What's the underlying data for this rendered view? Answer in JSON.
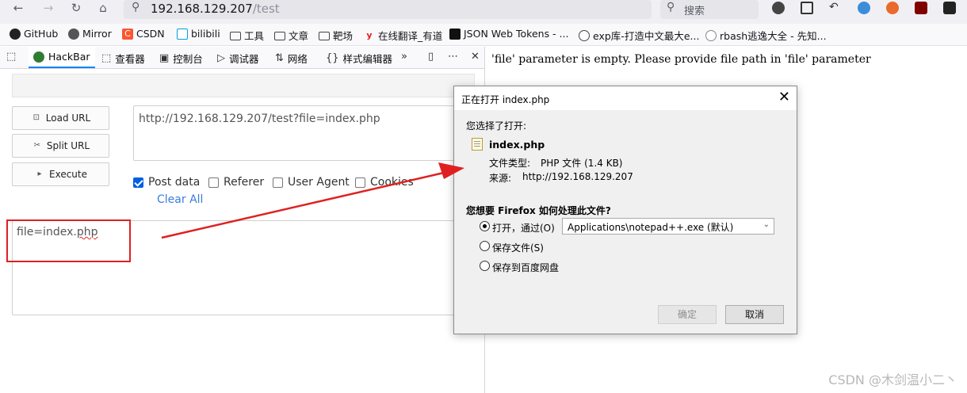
{
  "browser": {
    "url_host": "192.168.129.207",
    "url_path": "/test",
    "search_placeholder": "搜索"
  },
  "bookmarks": [
    {
      "label": "GitHub",
      "icon": "github-icon"
    },
    {
      "label": "Mirror",
      "icon": "mirror-icon"
    },
    {
      "label": "CSDN",
      "icon": "csdn-icon"
    },
    {
      "label": "bilibili",
      "icon": "bilibili-icon"
    },
    {
      "label": "工具",
      "icon": "folder-icon"
    },
    {
      "label": "文章",
      "icon": "folder-icon"
    },
    {
      "label": "靶场",
      "icon": "folder-icon"
    },
    {
      "label": "在线翻译_有道",
      "icon": "youdao-icon"
    },
    {
      "label": "JSON Web Tokens - ...",
      "icon": "jwt-icon"
    },
    {
      "label": "exp库-打造中文最大e...",
      "icon": "globe-icon"
    },
    {
      "label": "rbash逃逸大全 - 先知...",
      "icon": "xianzhi-icon"
    }
  ],
  "devtools": {
    "tabs": [
      {
        "label": "HackBar",
        "icon": "hackbar-icon"
      },
      {
        "label": "查看器",
        "icon": "inspector-icon"
      },
      {
        "label": "控制台",
        "icon": "console-icon"
      },
      {
        "label": "调试器",
        "icon": "debugger-icon"
      },
      {
        "label": "网络",
        "icon": "network-icon"
      },
      {
        "label": "样式编辑器",
        "icon": "style-editor-icon"
      }
    ]
  },
  "hackbar": {
    "load_url": "Load URL",
    "split_url": "Split URL",
    "execute": "Execute",
    "url_value": "http://192.168.129.207/test?file=index.php",
    "options": [
      {
        "label": "Post data",
        "checked": true
      },
      {
        "label": "Referer",
        "checked": false
      },
      {
        "label": "User Agent",
        "checked": false
      },
      {
        "label": "Cookies",
        "checked": false
      }
    ],
    "clear_all": "Clear All",
    "post_value_prefix": "file=index.",
    "post_value_suffix": "php"
  },
  "page": {
    "message": "'file' parameter is empty. Please provide file path in 'file' parameter"
  },
  "dialog": {
    "title": "正在打开 index.php",
    "you_chose": "您选择了打开:",
    "file_name": "index.php",
    "type_label": "文件类型:",
    "type_value": "PHP 文件 (1.4 KB)",
    "source_label": "来源:",
    "source_value": "http://192.168.129.207",
    "question": "您想要 Firefox 如何处理此文件?",
    "open_with": "打开，通过(O)",
    "app_selected": "Applications\\notepad++.exe (默认)",
    "save_file": "保存文件(S)",
    "save_baidu": "保存到百度网盘",
    "ok": "确定",
    "cancel": "取消"
  },
  "watermark": "CSDN @木剑温小二丶",
  "colors": {
    "annotation_red": "#e02020",
    "link_blue": "#3b7ddd",
    "checkbox_blue": "#0060df"
  }
}
